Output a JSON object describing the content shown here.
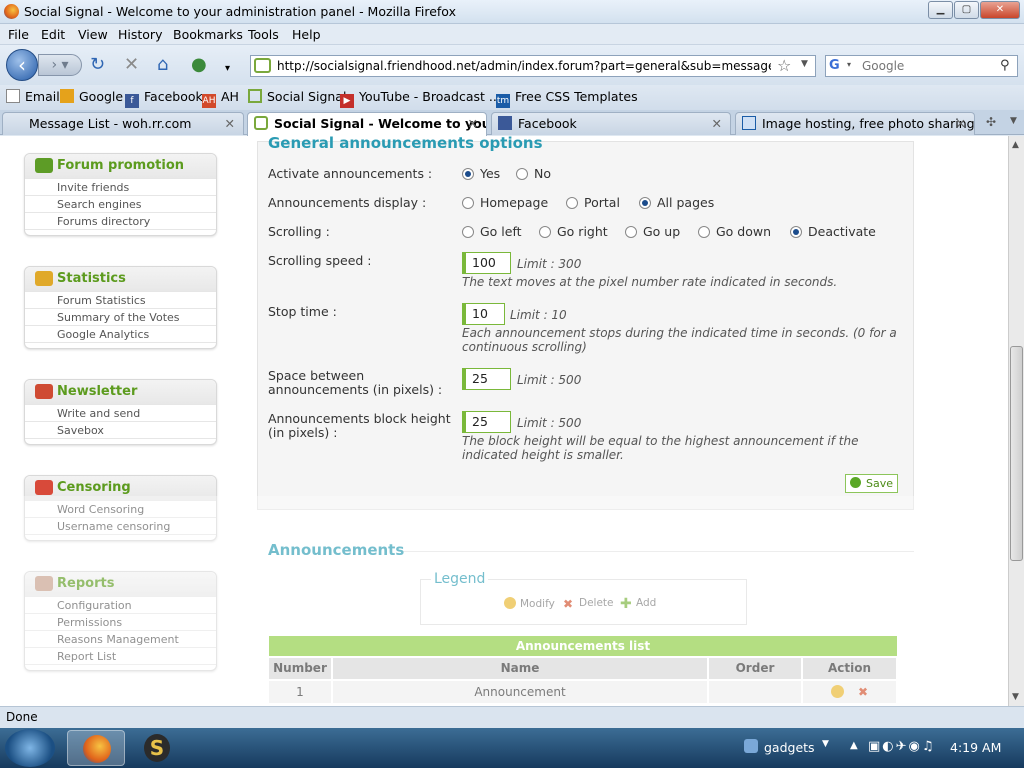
{
  "window": {
    "title": "Social Signal - Welcome to your administration panel - Mozilla Firefox"
  },
  "menu": [
    "File",
    "Edit",
    "View",
    "History",
    "Bookmarks",
    "Tools",
    "Help"
  ],
  "nav": {
    "url": "http://socialsignal.friendhood.net/admin/index.forum?part=general&sub=messages&mode=",
    "search_placeholder": "Google"
  },
  "bookmarks": [
    "Email",
    "Google",
    "Facebook",
    "AH",
    "Social Signal",
    "YouTube - Broadcast ...",
    "Free CSS Templates"
  ],
  "tabs": [
    {
      "label": "Message List - woh.rr.com"
    },
    {
      "label": "Social Signal - Welcome to your ..."
    },
    {
      "label": "Facebook"
    },
    {
      "label": "Image hosting, free photo sharing ..."
    }
  ],
  "sidebar": [
    {
      "title": "Forum promotion",
      "items": [
        "Invite friends",
        "Search engines",
        "Forums directory"
      ]
    },
    {
      "title": "Statistics",
      "items": [
        "Forum Statistics",
        "Summary of the Votes",
        "Google Analytics"
      ]
    },
    {
      "title": "Newsletter",
      "items": [
        "Write and send",
        "Savebox"
      ]
    },
    {
      "title": "Censoring",
      "items": [
        "Word Censoring",
        "Username censoring"
      ]
    },
    {
      "title": "Reports",
      "items": [
        "Configuration",
        "Permissions",
        "Reasons Management",
        "Report List"
      ]
    }
  ],
  "options": {
    "title": "General announcements options",
    "activate": {
      "label": "Activate announcements :",
      "options": [
        "Yes",
        "No"
      ]
    },
    "display": {
      "label": "Announcements display :",
      "options": [
        "Homepage",
        "Portal",
        "All pages"
      ]
    },
    "scrolling": {
      "label": "Scrolling :",
      "options": [
        "Go left",
        "Go right",
        "Go up",
        "Go down",
        "Deactivate"
      ]
    },
    "speed": {
      "label": "Scrolling speed :",
      "value": "100",
      "limit": "Limit : 300",
      "hint": "The text moves at the pixel number rate indicated in seconds."
    },
    "stop": {
      "label": "Stop time :",
      "value": "10",
      "limit": "Limit : 10",
      "hint": "Each announcement stops during the indicated time in seconds. (0 for a continuous scrolling)"
    },
    "space": {
      "label": "Space between announcements (in pixels) :",
      "value": "25",
      "limit": "Limit : 500"
    },
    "height": {
      "label": "Announcements block height (in pixels) :",
      "value": "25",
      "limit": "Limit : 500",
      "hint": "The block height will be equal to the highest announcement if the indicated height is smaller."
    },
    "save": "Save"
  },
  "announcements": {
    "title": "Announcements",
    "legend": {
      "title": "Legend",
      "modify": "Modify",
      "delete": "Delete",
      "add": "Add"
    },
    "list_title": "Announcements list",
    "columns": [
      "Number",
      "Name",
      "Order",
      "Action"
    ],
    "rows": [
      {
        "number": "1",
        "name": "Announcement",
        "order": ""
      }
    ]
  },
  "status": "Done",
  "taskbar": {
    "tray_label": "gadgets",
    "time": "4:19 AM"
  },
  "colors": {
    "accent_green": "#8dcc3f",
    "title_teal": "#2a9bb3"
  }
}
